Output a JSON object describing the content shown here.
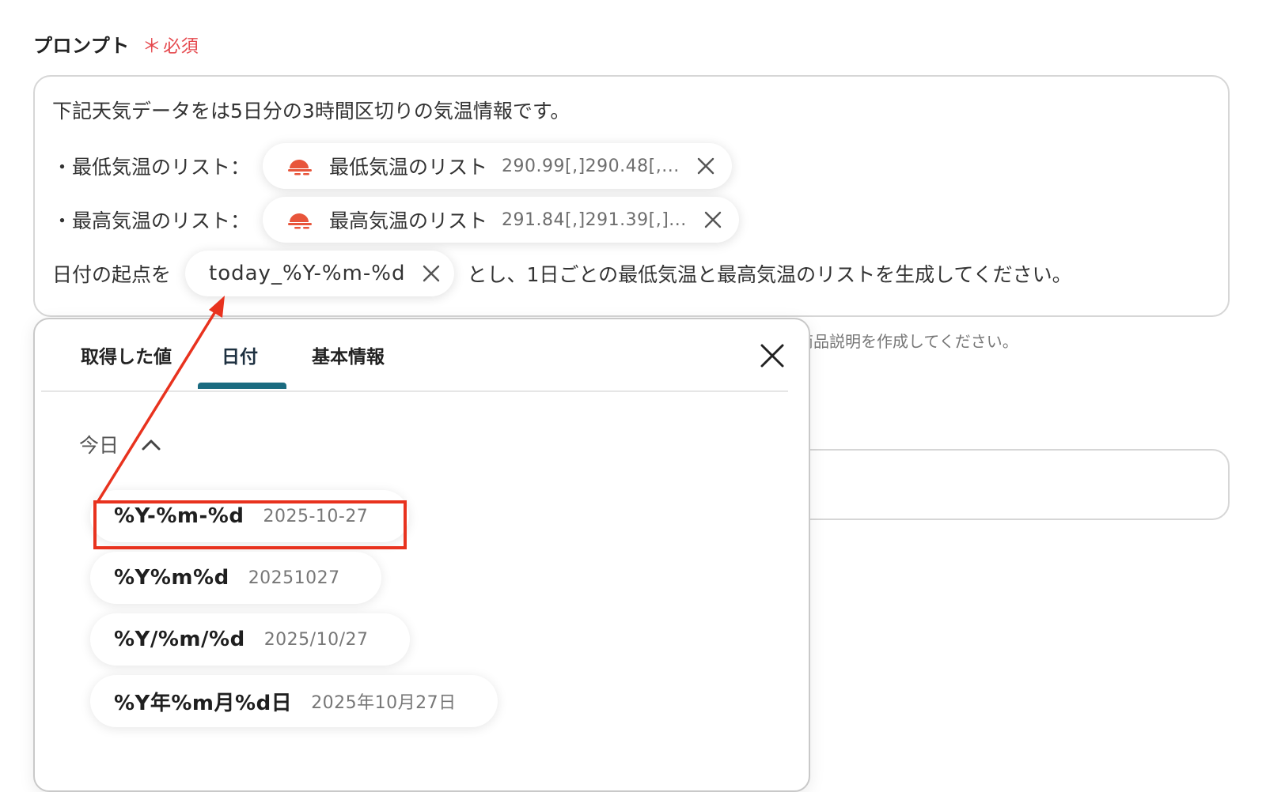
{
  "field": {
    "label": "プロンプト",
    "required_mark": "＊",
    "required_text": "必須"
  },
  "prompt": {
    "line1": "下記天気データをは5日分の3時間区切りの気温情報です。",
    "line2_prefix": "・最低気温のリスト：",
    "line2_chip_name": "最低気温のリスト",
    "line2_chip_value": "290.99[,]290.48[,...",
    "line3_prefix": "・最高気温のリスト：",
    "line3_chip_name": "最高気温のリスト",
    "line3_chip_value": "291.84[,]291.39[,]...",
    "line4_prefix": "日付の起点を",
    "line4_chip_name": "today_%Y-%m-%d",
    "line4_suffix": "とし、1日ごとの最低気温と最高気温のリストを生成してください。"
  },
  "behind_hint": "商品説明を作成してください。",
  "popup": {
    "tabs": [
      {
        "label": "取得した値"
      },
      {
        "label": "日付"
      },
      {
        "label": "基本情報"
      }
    ],
    "active_tab": "日付",
    "section_title": "今日",
    "options": [
      {
        "format": "%Y-%m-%d",
        "example": "2025-10-27"
      },
      {
        "format": "%Y%m%d",
        "example": "20251027"
      },
      {
        "format": "%Y/%m/%d",
        "example": "2025/10/27"
      },
      {
        "format": "%Y年%m月%d日",
        "example": "2025年10月27日"
      }
    ]
  },
  "colors": {
    "required": "#e5484d",
    "tab_indicator": "#1a6b80",
    "annotation": "#e8321e",
    "chip_icon": "#e8553b"
  },
  "icons": {
    "chip_icon": "weather-icon",
    "chip_close": "close-icon",
    "popup_close": "close-icon",
    "section_toggle": "chevron-up-icon"
  }
}
